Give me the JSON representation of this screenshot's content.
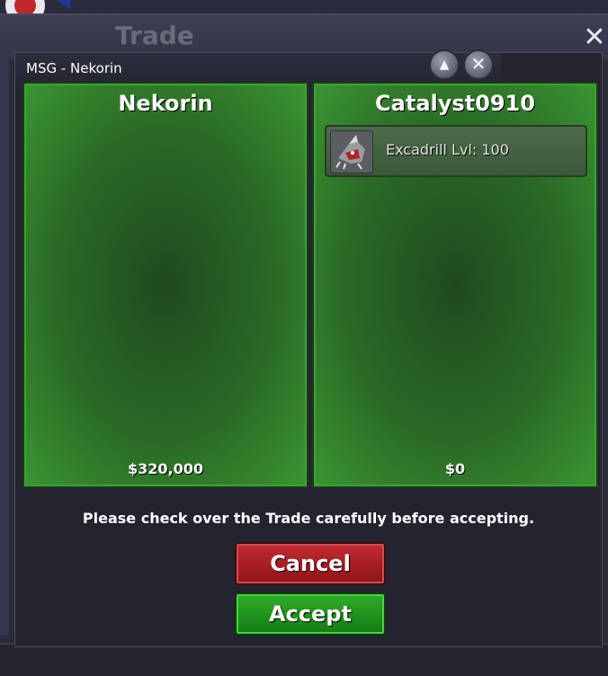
{
  "trade_window": {
    "title": "Trade",
    "close_label": "✕"
  },
  "msg_dialog": {
    "title": "MSG - Nekorin",
    "minimize_label": "▲",
    "close_label": "✕"
  },
  "left_panel": {
    "name": "Nekorin",
    "money": "$320,000",
    "items": []
  },
  "right_panel": {
    "name": "Catalyst0910",
    "money": "$0",
    "items": [
      {
        "label": "Excadrill  Lvl: 100",
        "icon": "excadrill-sprite-icon"
      }
    ]
  },
  "notice": "Please check over the Trade carefully before accepting.",
  "buttons": {
    "cancel": "Cancel",
    "accept": "Accept"
  },
  "colors": {
    "panel_green": "#2a6a26",
    "cancel_red": "#a81e24",
    "accept_green": "#1f9a1c",
    "window_bg": "#242430"
  }
}
